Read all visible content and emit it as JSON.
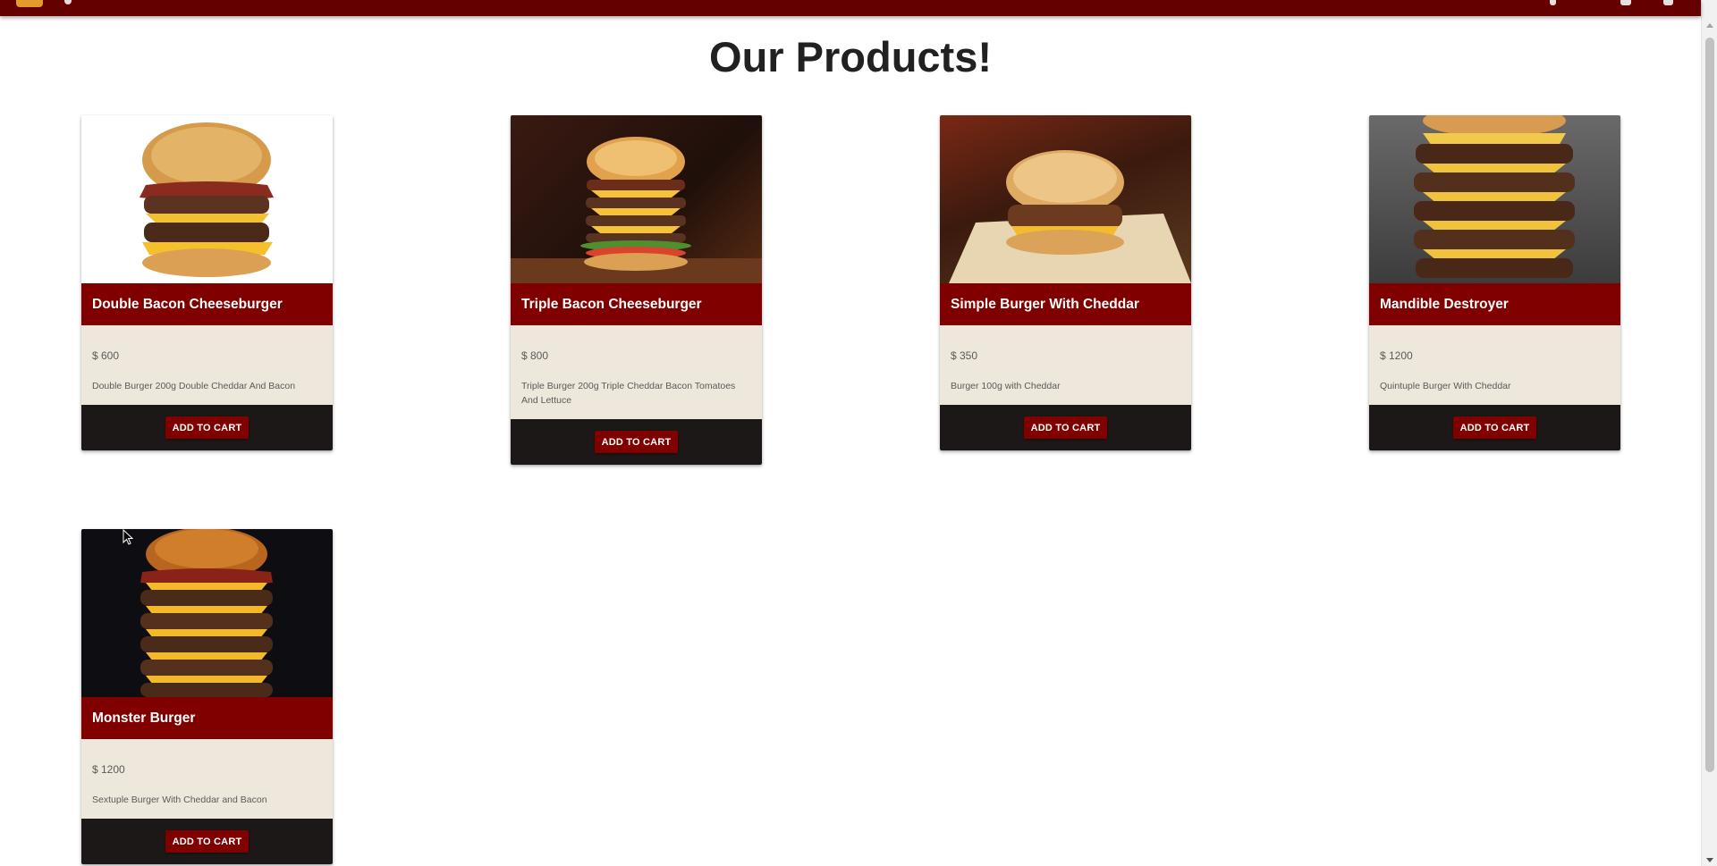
{
  "header": {
    "brand_color": "#650000",
    "logo_icon": "burger-logo-icon"
  },
  "page": {
    "title": "Our Products!"
  },
  "colors": {
    "title_bar": "#800000",
    "content_bg": "#ede8db",
    "action_bg": "#1c1818",
    "button": "#800000"
  },
  "products": [
    {
      "name": "Double Bacon Cheeseburger",
      "price": "$ 600",
      "description": "Double Burger 200g Double Cheddar And Bacon",
      "button_label": "ADD TO CART"
    },
    {
      "name": "Triple Bacon Cheeseburger",
      "price": "$ 800",
      "description": "Triple Burger 200g Triple Cheddar Bacon Tomatoes And Lettuce",
      "button_label": "ADD TO CART"
    },
    {
      "name": "Simple Burger With Cheddar",
      "price": "$ 350",
      "description": "Burger 100g with Cheddar",
      "button_label": "ADD TO CART"
    },
    {
      "name": "Mandible Destroyer",
      "price": "$ 1200",
      "description": "Quintuple Burger With Cheddar",
      "button_label": "ADD TO CART"
    },
    {
      "name": "Monster Burger",
      "price": "$ 1200",
      "description": "Sextuple Burger With Cheddar and Bacon",
      "button_label": "ADD TO CART"
    }
  ]
}
